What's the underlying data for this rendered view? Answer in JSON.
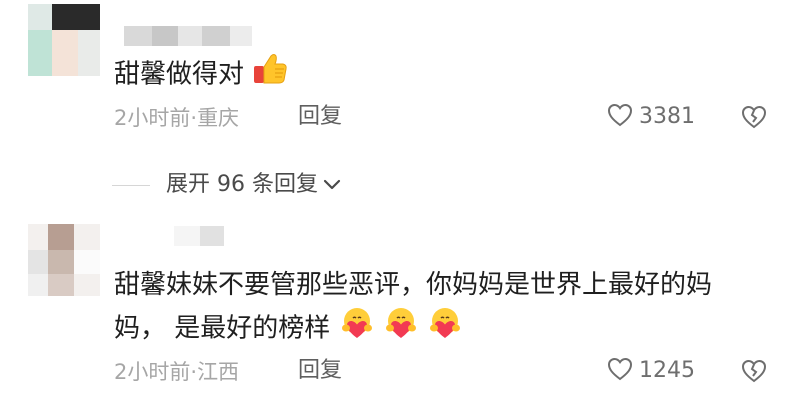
{
  "comments": [
    {
      "text": "甜馨做得对",
      "emoji": "thumbs-up-icon",
      "time": "2小时前",
      "separator": "·",
      "location": "重庆",
      "reply_label": "回复",
      "like_count": "3381"
    },
    {
      "text_line1": "甜馨妹妹不要管那些恶评，你妈妈是世界上最好的妈",
      "text_line2": "妈， 是最好的榜样",
      "emoji": "heart-hug-face-icon",
      "time": "2小时前",
      "separator": "·",
      "location": "江西",
      "reply_label": "回复",
      "like_count": "1245"
    }
  ],
  "expand_replies": {
    "label": "展开 96 条回复"
  },
  "colors": {
    "text": "#1f1f1f",
    "meta": "#a6a6a6",
    "reply": "#5f5f5f"
  }
}
